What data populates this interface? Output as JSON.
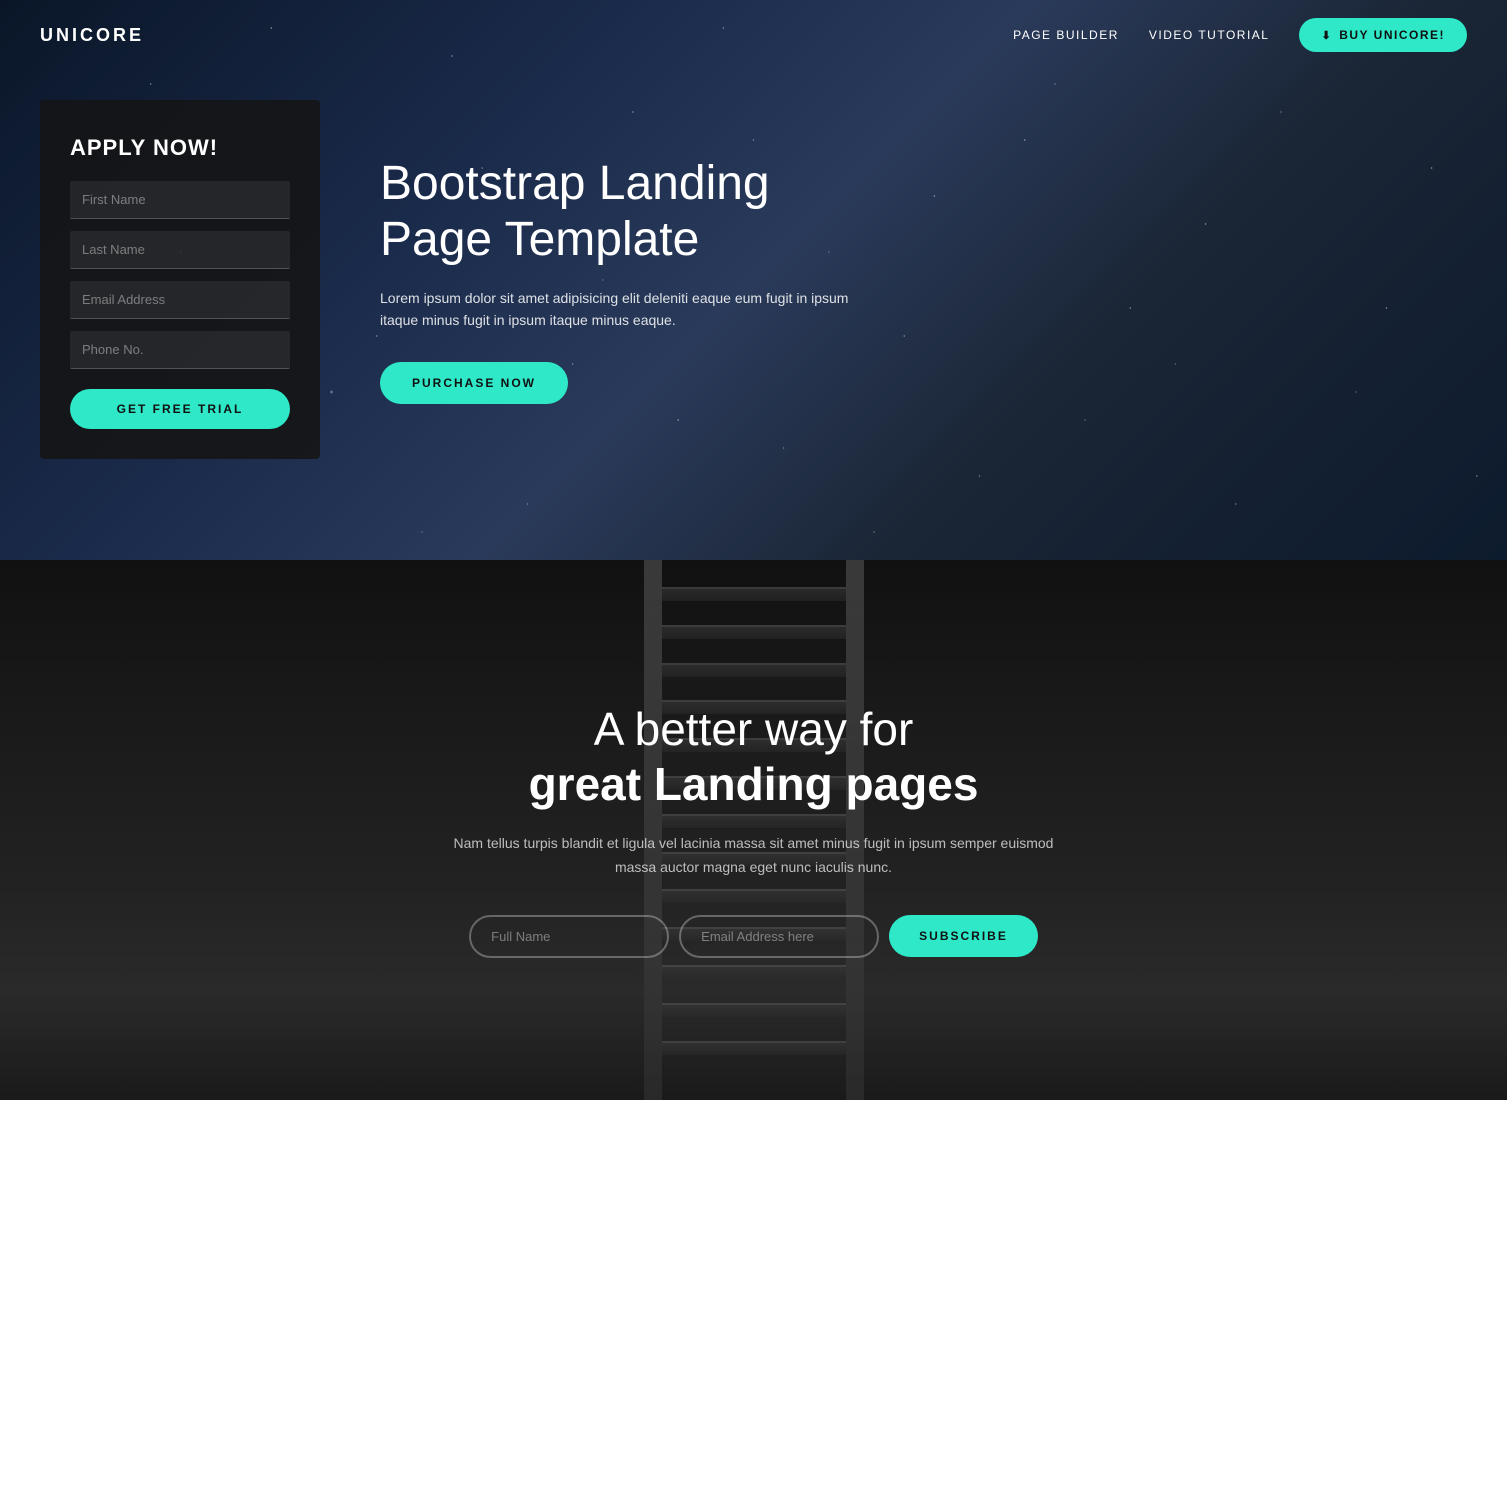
{
  "brand": "UNICORE",
  "navbar": {
    "links": [
      {
        "label": "PAGE BUILDER",
        "id": "page-builder"
      },
      {
        "label": "VIDEO TUTORIAL",
        "id": "video-tutorial"
      }
    ],
    "cta_label": "BUY UNICORE!"
  },
  "hero": {
    "form": {
      "title": "APPLY NOW!",
      "fields": [
        {
          "placeholder": "First Name",
          "id": "first-name"
        },
        {
          "placeholder": "Last Name",
          "id": "last-name"
        },
        {
          "placeholder": "Email Address",
          "id": "email-address"
        },
        {
          "placeholder": "Phone No.",
          "id": "phone-no"
        }
      ],
      "button_label": "GET FREE TRIAL"
    },
    "heading": "Bootstrap Landing Page Template",
    "description": "Lorem ipsum dolor sit amet adipisicing elit deleniti eaque eum fugit in ipsum itaque minus fugit in ipsum itaque minus eaque.",
    "purchase_button": "PURCHASE NOW"
  },
  "section2": {
    "heading_line1": "A better way for",
    "heading_line2": "great Landing pages",
    "description": "Nam tellus turpis blandit et ligula vel lacinia massa sit amet minus fugit in ipsum semper euismod massa auctor magna eget nunc iaculis nunc.",
    "subscribe": {
      "full_name_placeholder": "Full Name",
      "email_placeholder": "Email Address here",
      "button_label": "SUBSCRIBE"
    }
  },
  "colors": {
    "accent": "#2ee8c8",
    "dark": "#111111",
    "hero_bg_dark": "#0a1628"
  }
}
